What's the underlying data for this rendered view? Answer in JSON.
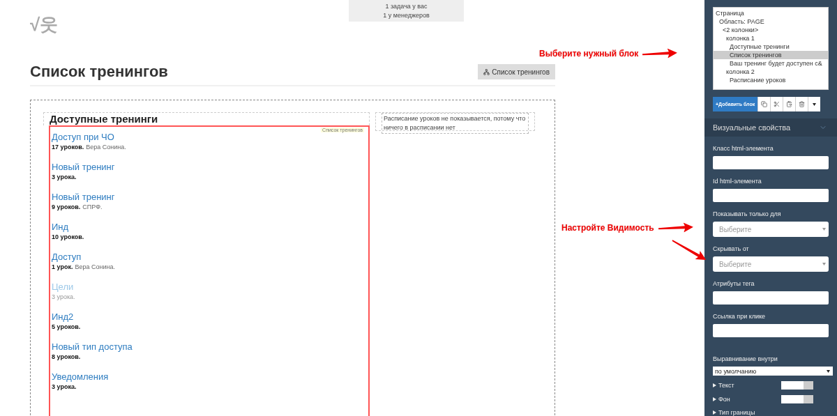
{
  "logo": {
    "text": "√웃"
  },
  "notice": {
    "lines": [
      "1 задача у вас",
      "1 у менеджеров"
    ]
  },
  "page": {
    "title": "Список тренингов",
    "structure_button": "Список тренингов"
  },
  "columns": {
    "left": {
      "heading": "Доступные тренинги",
      "block_label": "Список тренингов",
      "trainings": [
        {
          "title": "Доступ при ЧО",
          "count": "17 уроков.",
          "author": "Вера Сонина.",
          "disabled": false
        },
        {
          "title": "Новый тренинг",
          "count": "3 урока.",
          "disabled": false
        },
        {
          "title": "Новый тренинг",
          "count": "9 уроков.",
          "author": "СПРФ.",
          "disabled": false
        },
        {
          "title": "Инд",
          "count": "10 уроков.",
          "disabled": false
        },
        {
          "title": "Доступ",
          "count": "1 урок.",
          "author": "Вера Сонина.",
          "disabled": false
        },
        {
          "title": "Цели",
          "count": "3 урока.",
          "disabled": true
        },
        {
          "title": "Инд2",
          "count": "5 уроков.",
          "disabled": false
        },
        {
          "title": "Новый тип доступа",
          "count": "8 уроков.",
          "disabled": false
        },
        {
          "title": "Уведомления",
          "count": "3 урока.",
          "disabled": false
        }
      ]
    },
    "right": {
      "text": "Расписание уроков не показывается, потому что ничего в расписании нет"
    }
  },
  "annotations": [
    {
      "text": "Выберите нужный блок"
    },
    {
      "text": "Настройте Видимость"
    }
  ],
  "sidebar": {
    "tree": [
      {
        "label": "Страница",
        "selected": false,
        "children": [
          {
            "label": "Область: PAGE",
            "selected": false,
            "children": [
              {
                "label": "<2 колонки>",
                "selected": false,
                "children": [
                  {
                    "label": "колонка 1",
                    "selected": false,
                    "children": [
                      {
                        "label": "Доступные тренинги",
                        "selected": false
                      },
                      {
                        "label": "Список тренингов",
                        "selected": true
                      },
                      {
                        "label": "Ваш тренинг будет доступен c&",
                        "selected": false
                      }
                    ]
                  },
                  {
                    "label": "колонка 2",
                    "selected": false,
                    "children": [
                      {
                        "label": "Расписание уроков",
                        "selected": false
                      }
                    ]
                  }
                ]
              }
            ]
          }
        ]
      }
    ],
    "add_button": "+Добавить блок",
    "section_title": "Визуальные свойства",
    "fields": [
      {
        "kind": "input",
        "label": "Класс html-элемента"
      },
      {
        "kind": "input",
        "label": "Id html-элемента"
      },
      {
        "kind": "select",
        "label": "Показывать только для",
        "placeholder": "Выберите"
      },
      {
        "kind": "select",
        "label": "Скрывать от",
        "placeholder": "Выберите"
      },
      {
        "kind": "input",
        "label": "Атрибуты тега"
      },
      {
        "kind": "input",
        "label": "Ссылка при клике"
      },
      {
        "kind": "native",
        "label": "Выравнивание внутри",
        "value": "по умолчанию"
      },
      {
        "kind": "color",
        "label": "Текст"
      },
      {
        "kind": "color",
        "label": "Фон"
      },
      {
        "kind": "collapsed",
        "label": "Тип границы"
      }
    ]
  }
}
